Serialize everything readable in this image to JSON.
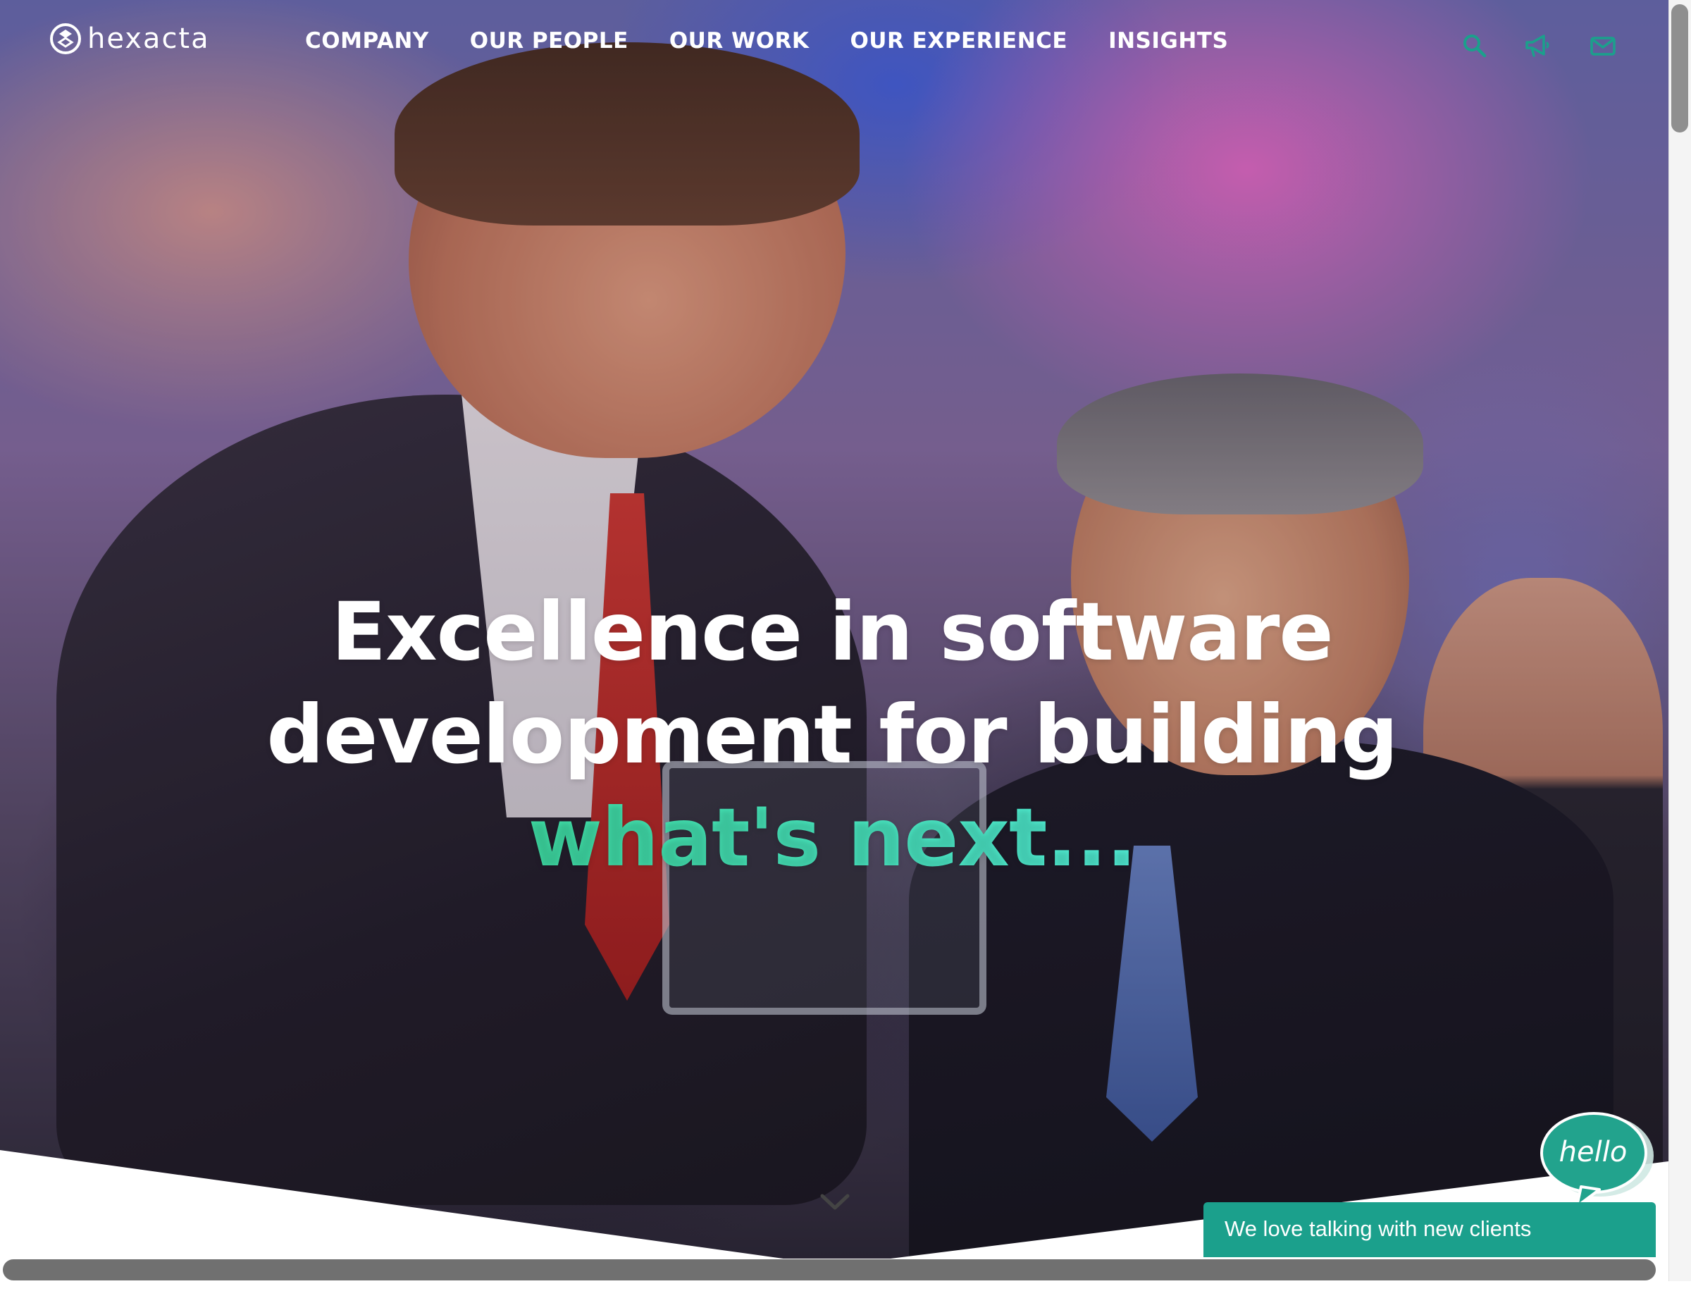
{
  "brand": {
    "logo_text": "hexacta",
    "accent_color": "#3fe0a6",
    "chat_color": "#1ba08c"
  },
  "nav": {
    "items": [
      {
        "label": "COMPANY"
      },
      {
        "label": "OUR PEOPLE"
      },
      {
        "label": "OUR WORK"
      },
      {
        "label": "OUR EXPERIENCE"
      },
      {
        "label": "INSIGHTS"
      }
    ]
  },
  "header_icons": [
    "search-icon",
    "megaphone-icon",
    "mail-icon"
  ],
  "hero": {
    "line1": "Excellence in software",
    "line2": "development for building",
    "line3_accent": "what's next..."
  },
  "chat": {
    "bubble_text": "hello",
    "bar_label": "We love talking with new clients"
  }
}
